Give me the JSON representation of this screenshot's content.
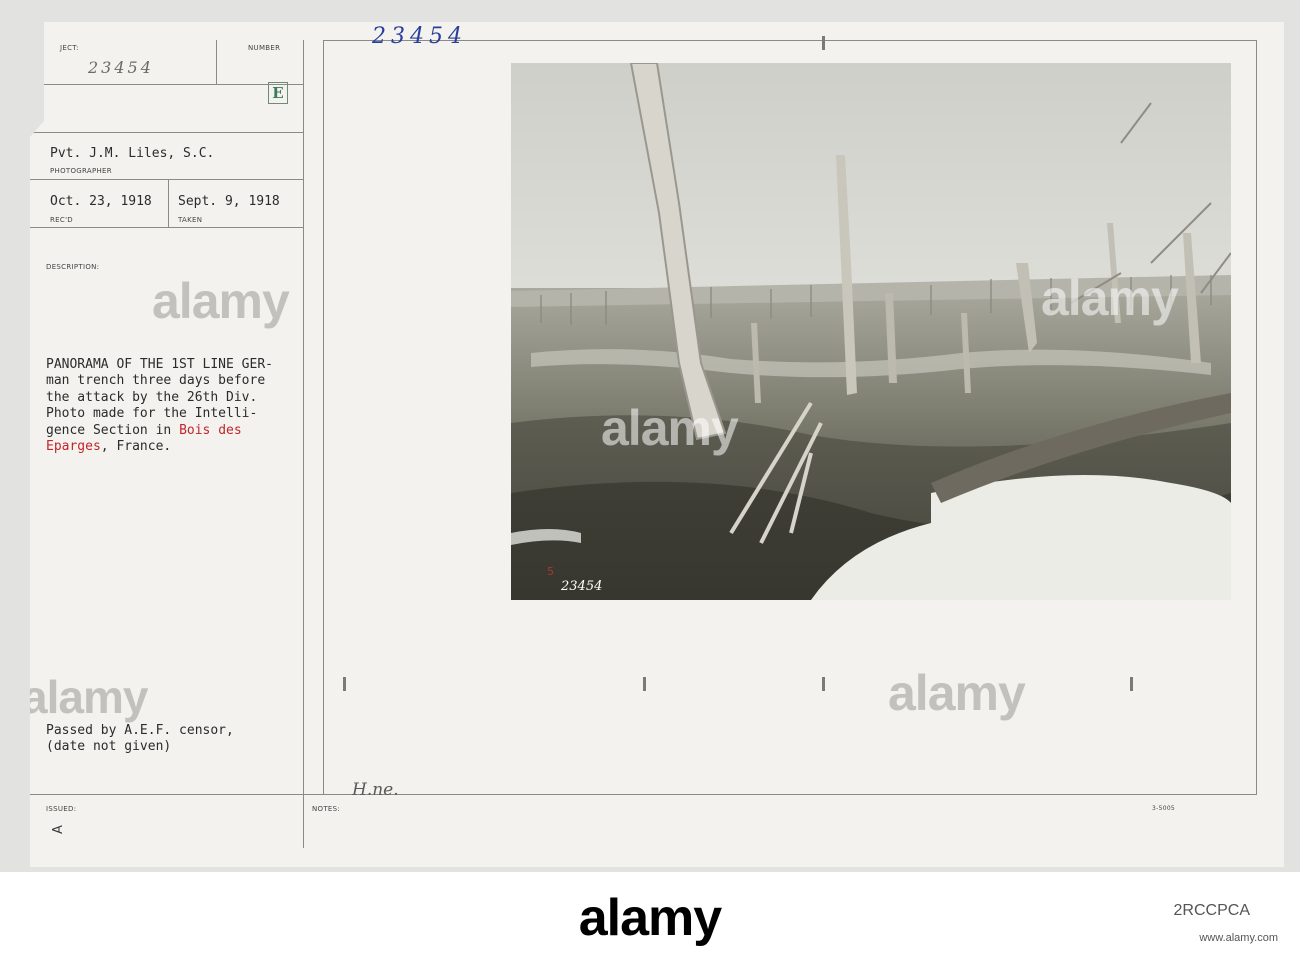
{
  "card": {
    "subject_label": "JECT:",
    "subject_handwritten": "23454",
    "number_label": "NUMBER",
    "number_value": "E",
    "top_handwritten": "23454",
    "photographer": "Pvt. J.M. Liles, S.C.",
    "photographer_label": "PHOTOGRAPHER",
    "received_date": "Oct. 23, 1918",
    "received_label": "REC'D",
    "taken_date": "Sept. 9, 1918",
    "taken_label": "TAKEN",
    "description_label": "DESCRIPTION:",
    "description_lines": [
      "PANORAMA OF THE 1ST LINE GER-",
      "man trench three days before",
      "the attack by the 26th Div.",
      "Photo made for the Intelli-",
      "gence Section in ",
      "Bois des",
      "Eparges",
      ", France."
    ],
    "censor_lines": [
      "Passed by A.E.F. censor,",
      "(date not given)"
    ],
    "issued_label": "ISSUED:",
    "issued_mark": "A",
    "notes_label": "NOTES:",
    "notes_handwritten": "H.ne.",
    "form_code": "3-5005",
    "photo_number": "23454",
    "photo_red_mark": "5"
  },
  "watermark": "alamy",
  "footer": {
    "logo": "alamy",
    "image_id": "2RCCPCA",
    "url": "www.alamy.com"
  },
  "colors": {
    "card": "#f3f2ee",
    "ink": "#2b2b2b",
    "handwriting": "#2a3f9a",
    "red_text": "#c4242b"
  }
}
